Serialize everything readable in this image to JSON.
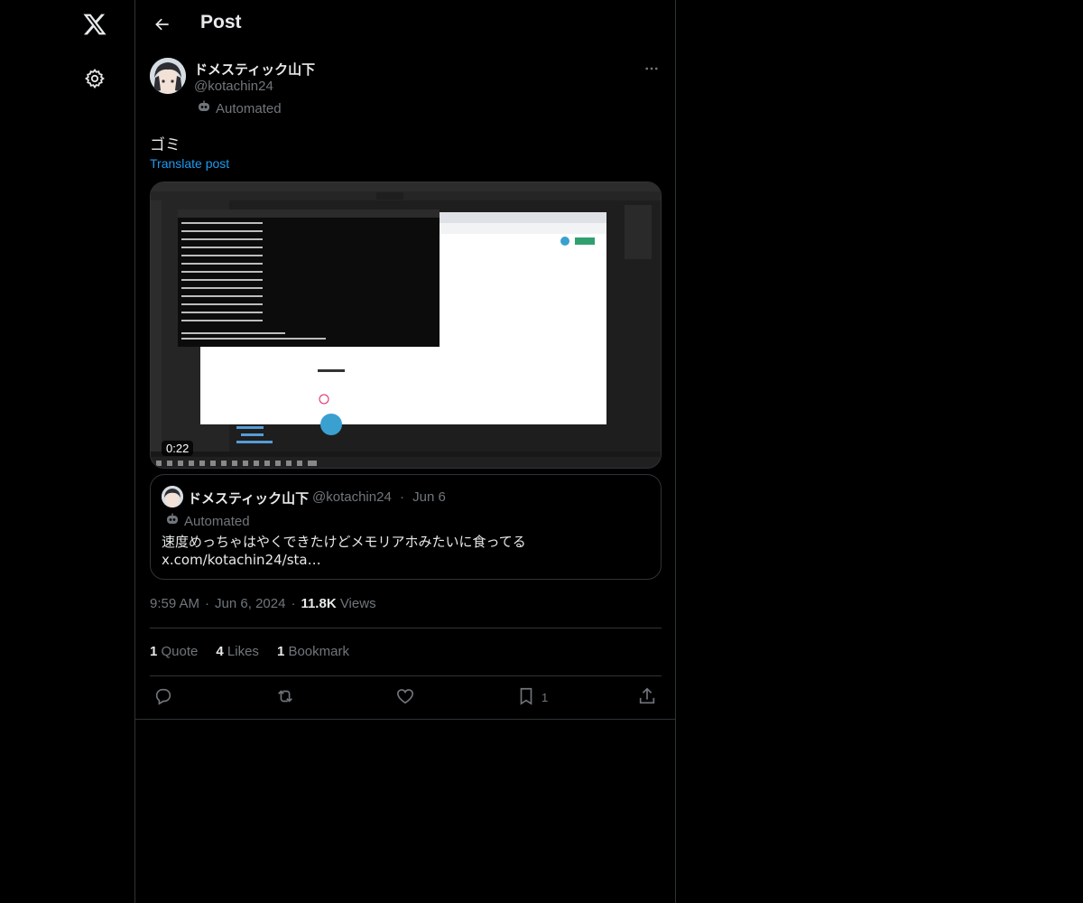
{
  "header": {
    "title": "Post",
    "back_icon": "arrow-left-icon"
  },
  "nav": {
    "logo_icon": "x-logo-icon",
    "settings_icon": "gear-icon"
  },
  "post": {
    "author": {
      "name": "ドメスティック山下",
      "handle": "@kotachin24",
      "badge": "Automated"
    },
    "text": "ゴミ",
    "translate_label": "Translate post",
    "media": {
      "duration": "0:22"
    },
    "quote": {
      "name": "ドメスティック山下",
      "handle": "@kotachin24",
      "separator": "·",
      "date": "Jun 6",
      "badge": "Automated",
      "text": "速度めっちゃはやくできたけどメモリアホみたいに食ってる",
      "link": "x.com/kotachin24/sta…"
    },
    "time": "9:59 AM",
    "date": "Jun 6, 2024",
    "views_count": "11.8K",
    "views_label": "Views",
    "stats": {
      "quotes_count": "1",
      "quotes_label": "Quote",
      "likes_count": "4",
      "likes_label": "Likes",
      "bookmarks_count": "1",
      "bookmarks_label": "Bookmark"
    },
    "actions": {
      "bookmark_count": "1"
    }
  },
  "colors": {
    "background": "#000000",
    "text": "#e7e9ea",
    "muted": "#71767b",
    "accent": "#1d9bf0",
    "border": "#2f3336"
  }
}
